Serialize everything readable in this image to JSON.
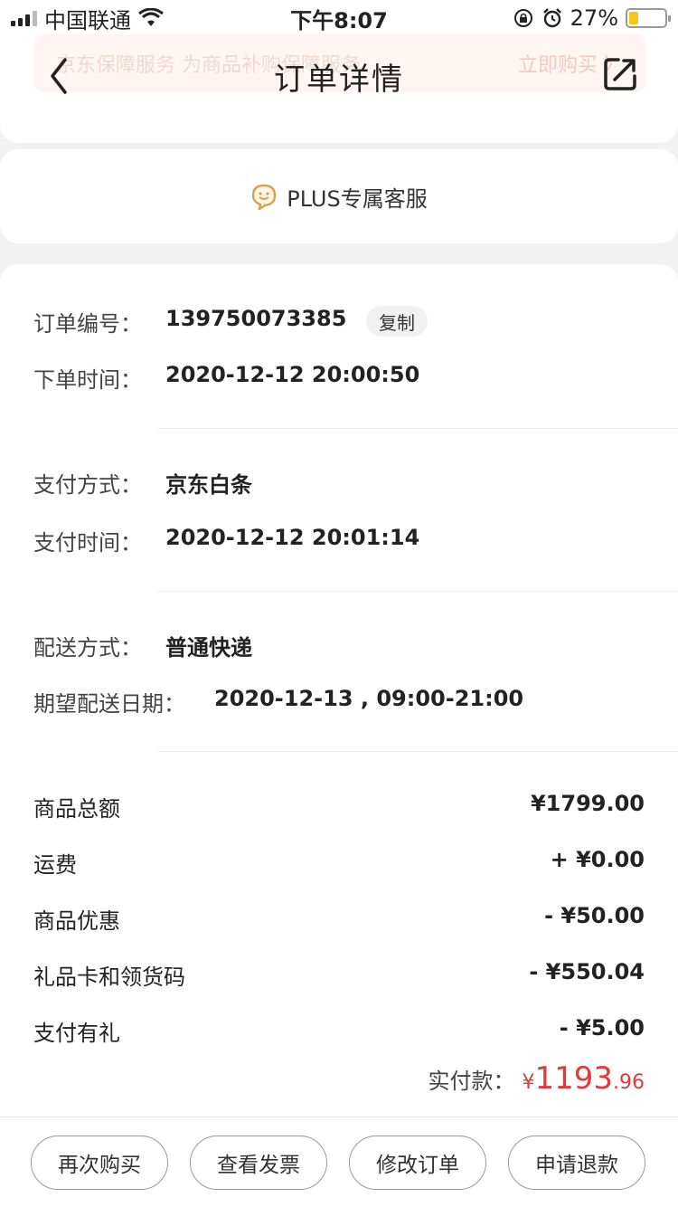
{
  "status_bar": {
    "carrier": "中国联通",
    "time": "下午8:07",
    "battery": "27%",
    "battery_level": 0.27
  },
  "banner": {
    "text": "京东保障服务  为商品补购保障服务",
    "cta": "立即购买 〉"
  },
  "nav": {
    "title": "订单详情"
  },
  "service": {
    "label": "PLUS专属客服"
  },
  "order": {
    "number_label": "订单编号：",
    "number": "139750073385",
    "copy_label": "复制",
    "order_time_label": "下单时间：",
    "order_time": "2020-12-12 20:00:50",
    "pay_method_label": "支付方式：",
    "pay_method": "京东白条",
    "pay_time_label": "支付时间：",
    "pay_time": "2020-12-12 20:01:14",
    "ship_method_label": "配送方式：",
    "ship_method": "普通快递",
    "expected_date_label": "期望配送日期：",
    "expected_date": "2020-12-13 , 09:00-21:00"
  },
  "fees": [
    {
      "label": "商品总额",
      "value": "¥1799.00"
    },
    {
      "label": "运费",
      "value": "+ ¥0.00"
    },
    {
      "label": "商品优惠",
      "value": "- ¥50.00"
    },
    {
      "label": "礼品卡和领货码",
      "value": "- ¥550.04"
    },
    {
      "label": "支付有礼",
      "value": "- ¥5.00"
    }
  ],
  "paid": {
    "label": "实付款：",
    "yen": "¥",
    "integer": "1193",
    "cents": ".96"
  },
  "actions": {
    "buy_again": "再次购买",
    "view_invoice": "查看发票",
    "modify_order": "修改订单",
    "request_refund": "申请退款"
  },
  "colors": {
    "accent": "#e4393c",
    "service_icon": "#d4a256"
  }
}
